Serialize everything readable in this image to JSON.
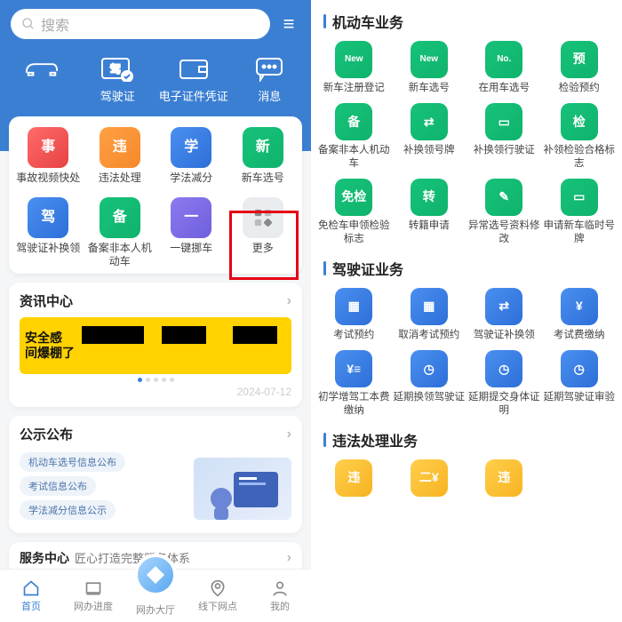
{
  "left": {
    "search_placeholder": "搜索",
    "blue_tabs": [
      "",
      "驾驶证",
      "电子证件凭证",
      "消息"
    ],
    "home_grid": [
      {
        "label": "事故视频快处",
        "color": "g-red"
      },
      {
        "label": "违法处理",
        "color": "g-orange"
      },
      {
        "label": "学法减分",
        "color": "g-blue"
      },
      {
        "label": "新车选号",
        "color": "g-green"
      },
      {
        "label": "驾驶证补换领",
        "color": "g-blue"
      },
      {
        "label": "备案非本人机动车",
        "color": "g-green"
      },
      {
        "label": "一键挪车",
        "color": "g-purple"
      },
      {
        "label": "更多",
        "color": "g-gray"
      }
    ],
    "news_title": "资讯中心",
    "news_banner_line1": "安全感",
    "news_banner_line2": "间爆棚了",
    "news_date": "2024-07-12",
    "gongshi_title": "公示公布",
    "gongshi_pills": [
      "机动车选号信息公布",
      "考试信息公布",
      "学法减分信息公示"
    ],
    "service_title": "服务中心",
    "service_sub": "匠心打造完整服务体系",
    "bottom_nav": [
      "首页",
      "网办进度",
      "网办大厅",
      "线下网点",
      "我的"
    ]
  },
  "right": {
    "section1": "机动车业务",
    "grid1": [
      {
        "label": "新车注册登记",
        "color": "g-green",
        "glyph": "New"
      },
      {
        "label": "新车选号",
        "color": "g-green",
        "glyph": "New"
      },
      {
        "label": "在用车选号",
        "color": "g-green",
        "glyph": "No."
      },
      {
        "label": "检验预约",
        "color": "g-green",
        "glyph": "预"
      },
      {
        "label": "备案非本人机动车",
        "color": "g-green",
        "glyph": "备"
      },
      {
        "label": "补换领号牌",
        "color": "g-green",
        "glyph": "⇄"
      },
      {
        "label": "补换领行驶证",
        "color": "g-green",
        "glyph": "▭"
      },
      {
        "label": "补领检验合格标志",
        "color": "g-green",
        "glyph": "检"
      },
      {
        "label": "免检车申领检验标志",
        "color": "g-green",
        "glyph": "免检"
      },
      {
        "label": "转籍申请",
        "color": "g-green",
        "glyph": "转"
      },
      {
        "label": "异常选号资料修改",
        "color": "g-green",
        "glyph": "✎"
      },
      {
        "label": "申请新车临时号牌",
        "color": "g-green",
        "glyph": "▭"
      }
    ],
    "section2": "驾驶证业务",
    "grid2": [
      {
        "label": "考试预约",
        "color": "g-blue",
        "glyph": "▦"
      },
      {
        "label": "取消考试预约",
        "color": "g-blue",
        "glyph": "▦"
      },
      {
        "label": "驾驶证补换领",
        "color": "g-blue",
        "glyph": "⇄"
      },
      {
        "label": "考试费缴纳",
        "color": "g-blue",
        "glyph": "¥"
      },
      {
        "label": "初学增驾工本费缴纳",
        "color": "g-blue",
        "glyph": "¥≡"
      },
      {
        "label": "延期换领驾驶证",
        "color": "g-blue",
        "glyph": "◷"
      },
      {
        "label": "延期提交身体证明",
        "color": "g-blue",
        "glyph": "◷"
      },
      {
        "label": "延期驾驶证审验",
        "color": "g-blue",
        "glyph": "◷"
      }
    ],
    "section3": "违法处理业务",
    "grid3": [
      {
        "label": "",
        "color": "g-yellow",
        "glyph": "违"
      },
      {
        "label": "",
        "color": "g-yellow",
        "glyph": "二¥"
      },
      {
        "label": "",
        "color": "g-yellow",
        "glyph": "违"
      }
    ]
  }
}
